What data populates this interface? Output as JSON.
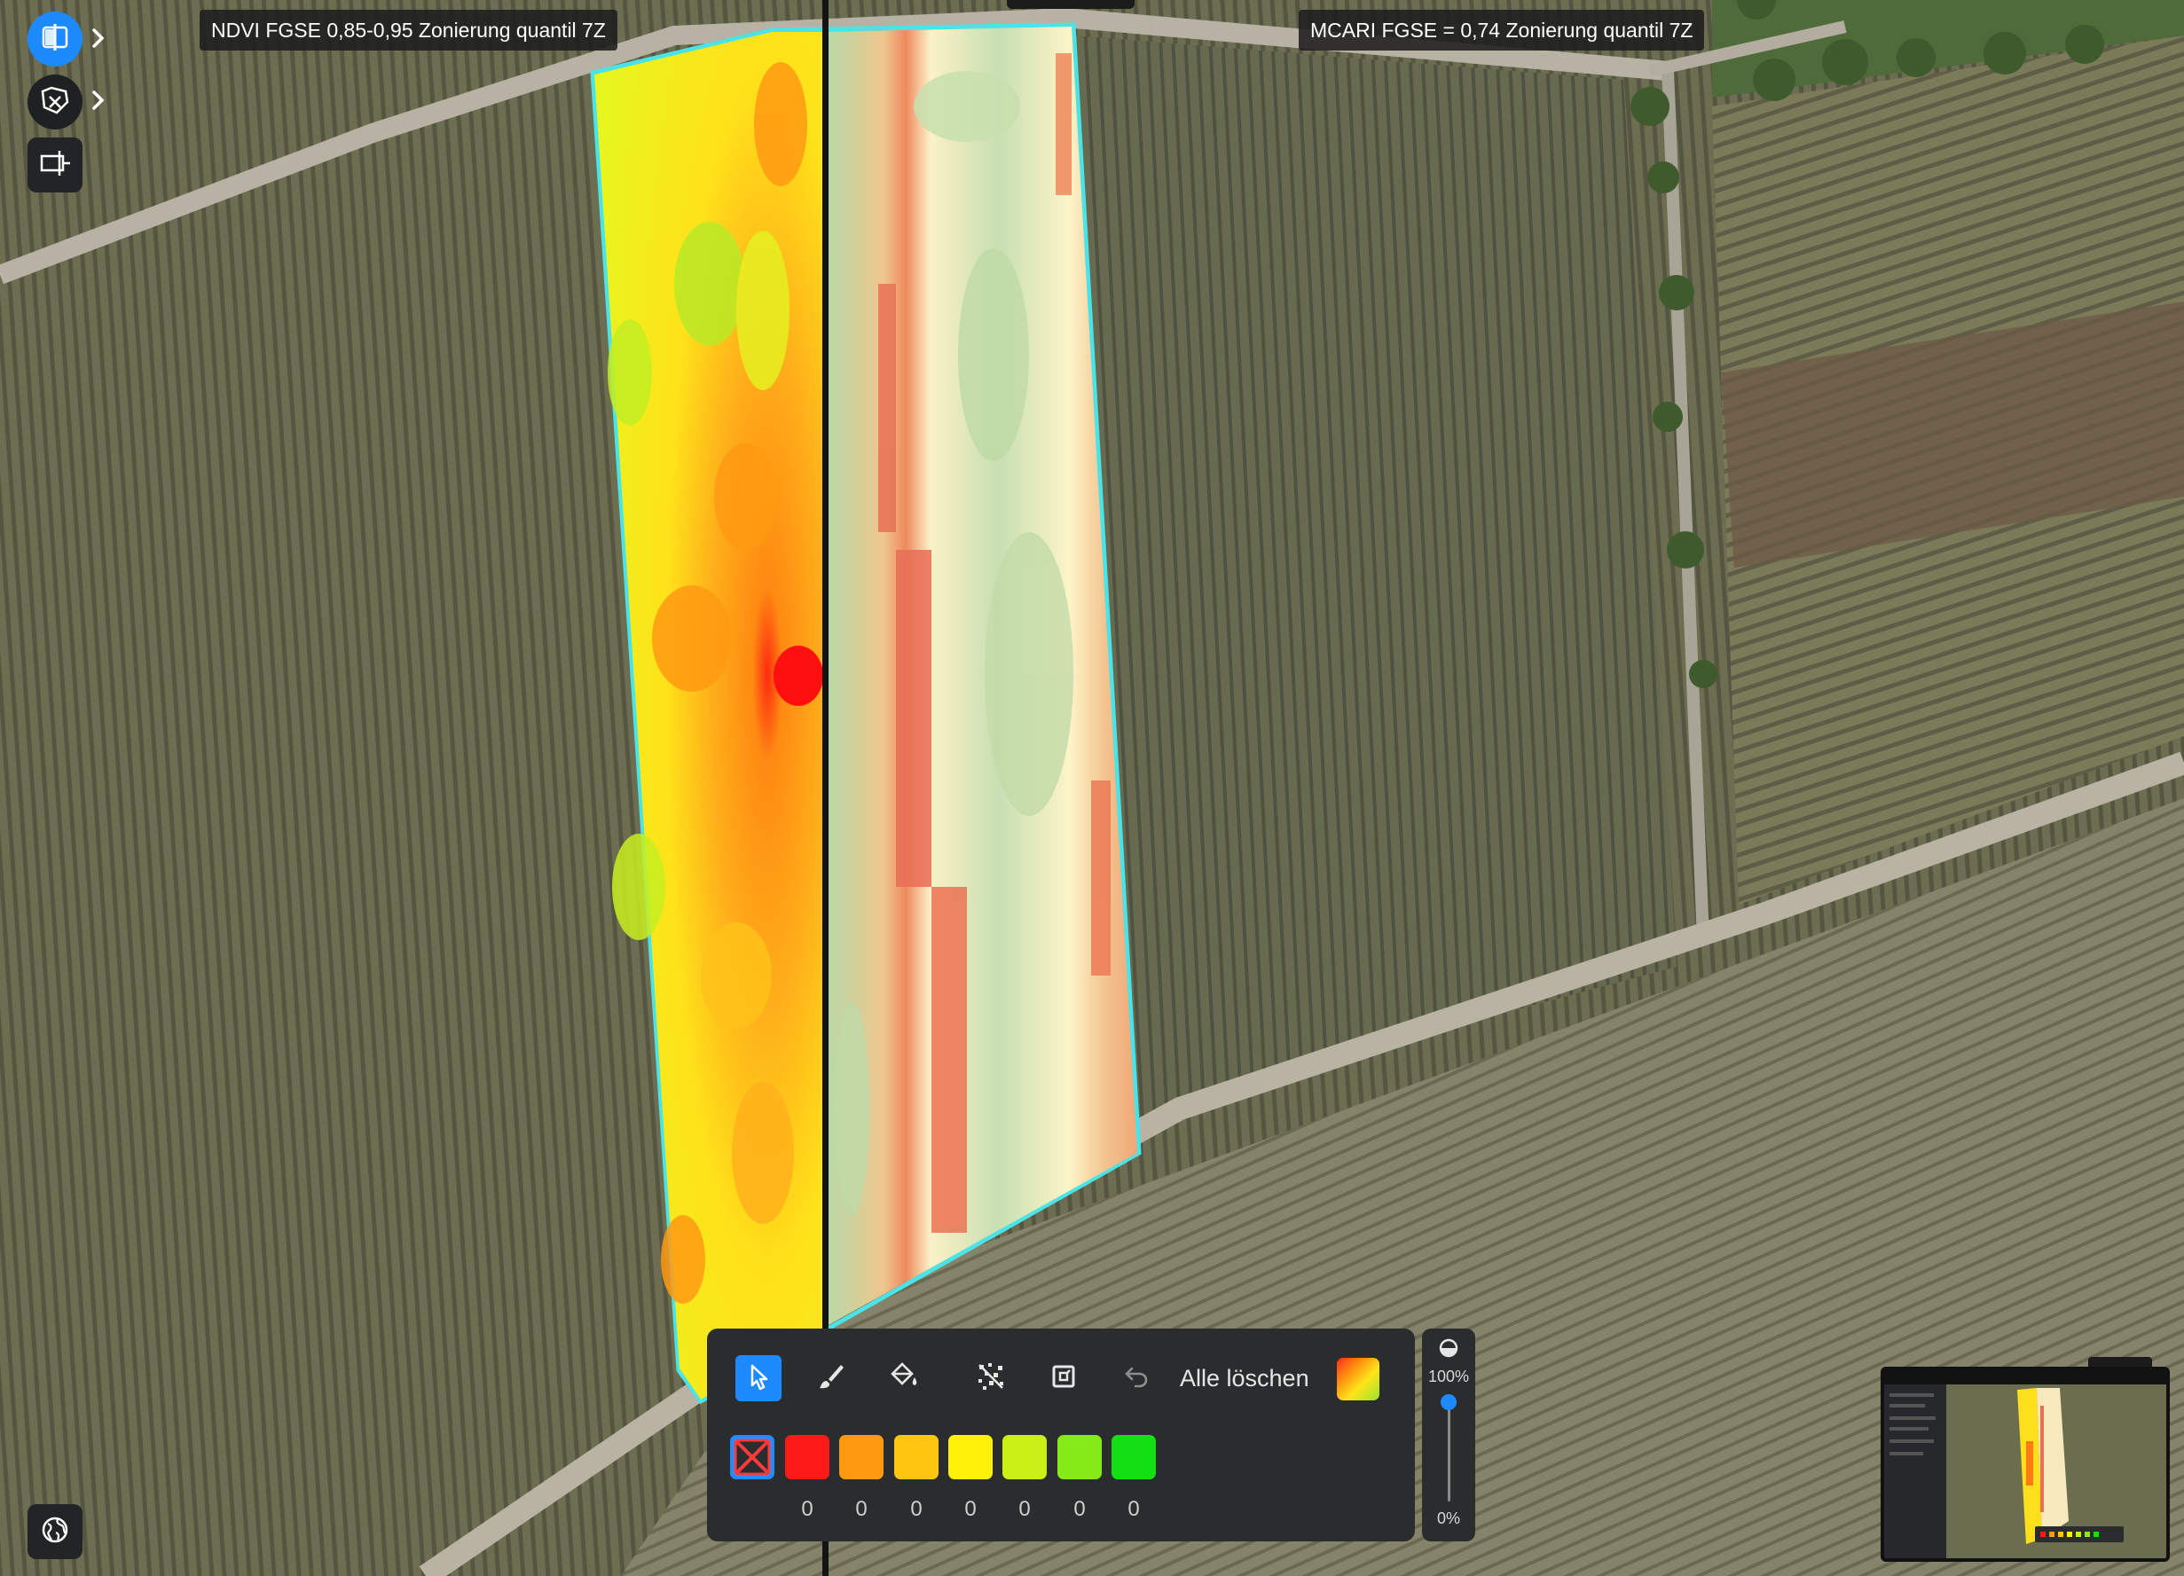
{
  "layers": {
    "left_label": "NDVI FGSE 0,85-0,95 Zonierung quantil 7Z",
    "right_label": "MCARI FGSE = 0,74 Zonierung quantil 7Z"
  },
  "left_toolbar": {
    "compare_icon": "split-compare-icon",
    "analysis_icon": "field-analysis-icon",
    "panel_icon": "panel-split-icon",
    "globe_icon": "globe-icon",
    "accent_color": "#1d8bff"
  },
  "edit_toolbar": {
    "clear_all_label": "Alle löschen",
    "tools": [
      "pointer-icon",
      "brush-icon",
      "fill-bucket-icon",
      "scatter-icon",
      "crop-icon",
      "undo-icon",
      "gradient-icon"
    ],
    "zones": [
      {
        "color": "#ff1a1a",
        "count": "0"
      },
      {
        "color": "#ff9a10",
        "count": "0"
      },
      {
        "color": "#ffc510",
        "count": "0"
      },
      {
        "color": "#fff10a",
        "count": "0"
      },
      {
        "color": "#c9f016",
        "count": "0"
      },
      {
        "color": "#86ea18",
        "count": "0"
      },
      {
        "color": "#12e012",
        "count": "0"
      }
    ],
    "none_swatch": "no-zone-icon"
  },
  "opacity": {
    "max_label": "100%",
    "min_label": "0%",
    "value": 1.0
  }
}
